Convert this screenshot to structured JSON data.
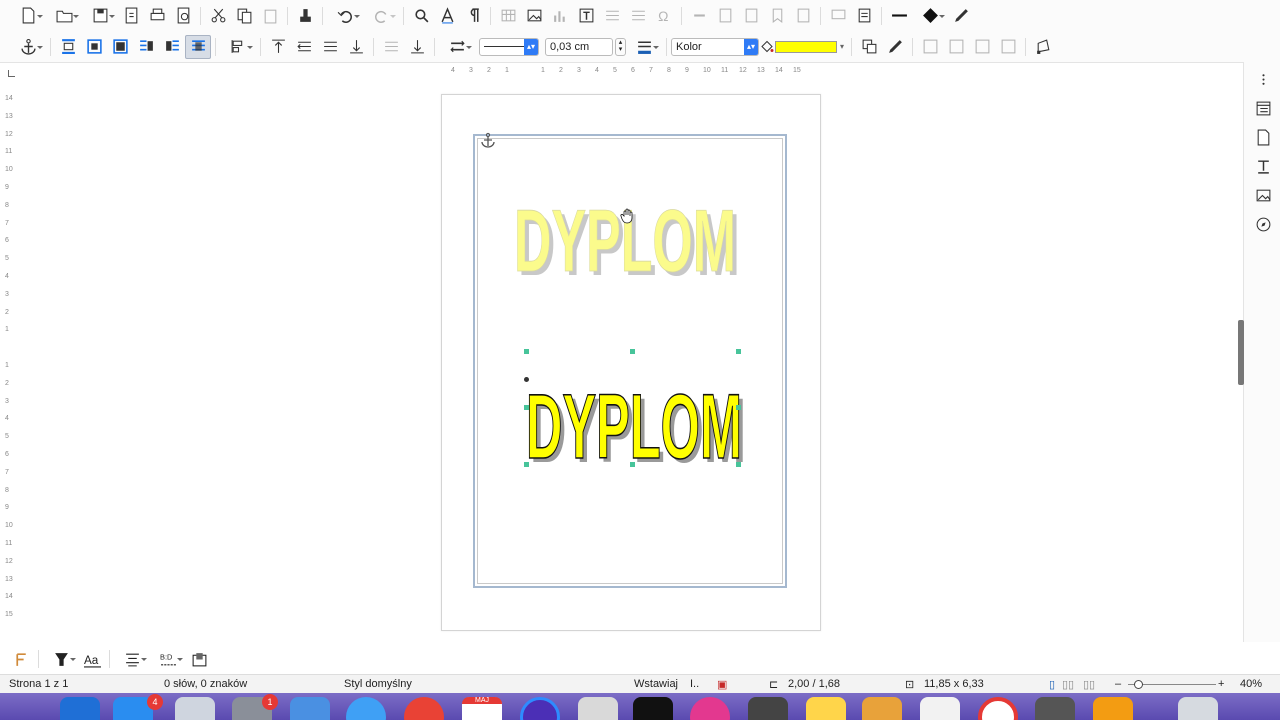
{
  "toolbar2": {
    "line_width": "0,03 cm",
    "fill_type": "Kolor",
    "fill_color": "#ffff00"
  },
  "ruler": {
    "horizontal": [
      "4",
      "3",
      "2",
      "1",
      "",
      "1",
      "2",
      "3",
      "4",
      "5",
      "6",
      "7",
      "8",
      "9",
      "10",
      "11",
      "12",
      "13",
      "14",
      "15"
    ],
    "vertical": [
      "14",
      "13",
      "12",
      "11",
      "10",
      "9",
      "8",
      "7",
      "6",
      "5",
      "4",
      "3",
      "2",
      "1",
      "",
      "1",
      "2",
      "3",
      "4",
      "5",
      "6",
      "7",
      "8",
      "9",
      "10",
      "11",
      "12",
      "13",
      "14",
      "15"
    ]
  },
  "document": {
    "wordart_top": {
      "text": "DYPLOM",
      "fill": "#fbfb8c",
      "shadow": "#c8c8c8"
    },
    "wordart_bottom": {
      "text": "DYPLOM",
      "fill": "#ffff00",
      "stroke": "#111111",
      "shadow": "#9a9a9a"
    },
    "accent_frame": "#a5b8cf",
    "handle_color": "#47c49a"
  },
  "statusbar": {
    "page": "Strona 1 z 1",
    "words": "0 słów, 0 znaków",
    "style": "Styl domyślny",
    "mode": "Wstawiaj",
    "position": "2,00 / 1,68",
    "size": "11,85 x 6,33",
    "zoom": "40%"
  },
  "dock": {
    "badges": {
      "appstore": "4",
      "settings": "1"
    },
    "calendar_month": "MAJ"
  }
}
